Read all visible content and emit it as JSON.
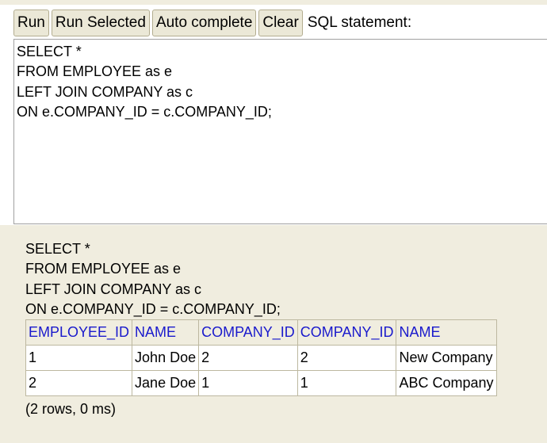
{
  "toolbar": {
    "run_label": "Run",
    "run_selected_label": "Run Selected",
    "auto_complete_label": "Auto complete",
    "clear_label": "Clear",
    "sql_statement_label": "SQL statement:"
  },
  "editor": {
    "value": "SELECT *\nFROM EMPLOYEE as e\nLEFT JOIN COMPANY as c\nON e.COMPANY_ID = c.COMPANY_ID;"
  },
  "result": {
    "echo": "SELECT *\nFROM EMPLOYEE as e\nLEFT JOIN COMPANY as c\nON e.COMPANY_ID = c.COMPANY_ID;",
    "columns": [
      "EMPLOYEE_ID",
      "NAME",
      "COMPANY_ID",
      "COMPANY_ID",
      "NAME"
    ],
    "rows": [
      [
        "1",
        "John Doe",
        "2",
        "2",
        "New Company"
      ],
      [
        "2",
        "Jane Doe",
        "1",
        "1",
        "ABC Company"
      ]
    ],
    "status": "(2 rows, 0 ms)"
  }
}
